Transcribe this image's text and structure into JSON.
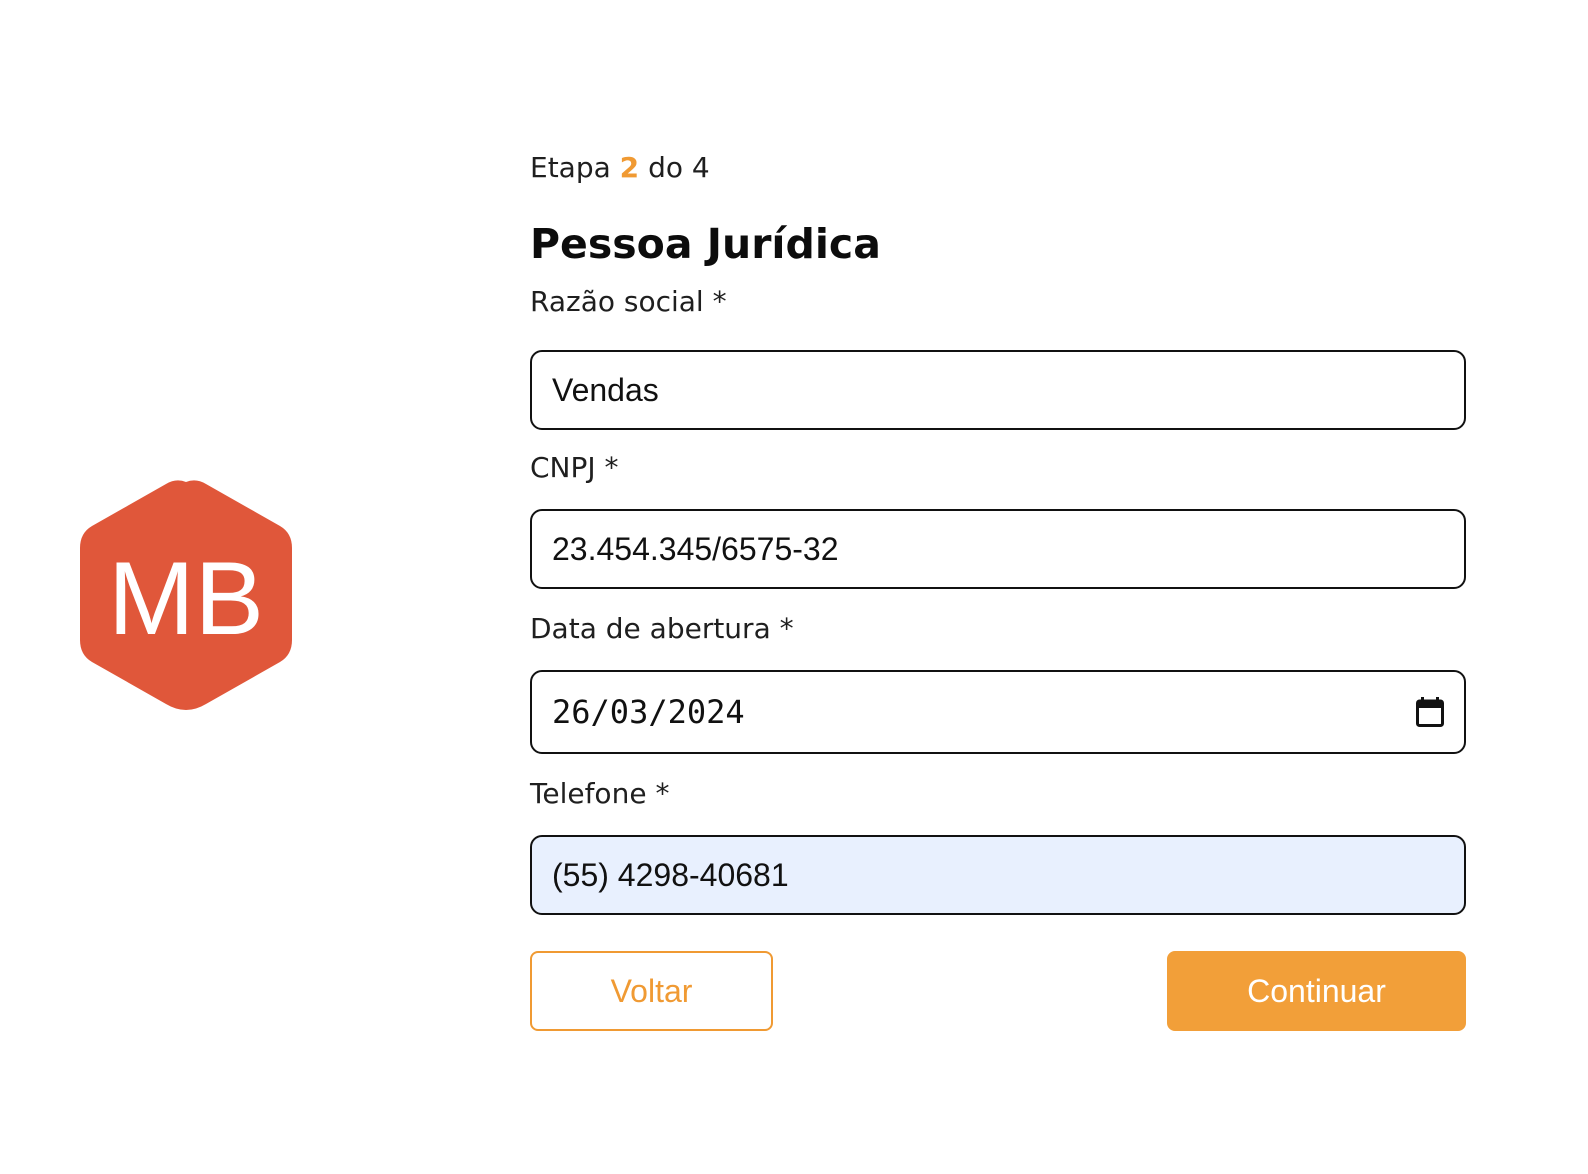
{
  "brand": {
    "logo_text": "MB",
    "logo_color": "#e0573a"
  },
  "step": {
    "prefix": "Etapa",
    "current": "2",
    "suffix": "do 4"
  },
  "title": "Pessoa Jurídica",
  "fields": {
    "razao_social": {
      "label": "Razão social *",
      "value": "Vendas"
    },
    "cnpj": {
      "label": "CNPJ *",
      "value": "23.454.345/6575-32"
    },
    "data_abertura": {
      "label": "Data de abertura *",
      "value": "26/03/2024",
      "icon": "calendar-icon"
    },
    "telefone": {
      "label": "Telefone *",
      "value": "(55) 4298-40681",
      "autofilled": true
    }
  },
  "buttons": {
    "back_label": "Voltar",
    "continue_label": "Continuar"
  },
  "colors": {
    "accent": "#f29f39",
    "autofill_bg": "#e8f0fe",
    "border": "#111111"
  }
}
